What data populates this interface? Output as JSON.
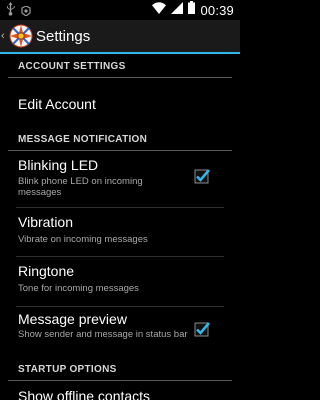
{
  "status_bar": {
    "time": "00:39",
    "icons": [
      "usb-icon",
      "android-debug-icon",
      "wifi-icon",
      "signal-icon",
      "battery-icon"
    ]
  },
  "action_bar": {
    "title": "Settings",
    "up_glyph": "‹"
  },
  "sections": {
    "account": {
      "header": "ACCOUNT SETTINGS",
      "items": {
        "edit_account": {
          "title": "Edit Account"
        }
      }
    },
    "message_notification": {
      "header": "MESSAGE NOTIFICATION",
      "items": {
        "blinking_led": {
          "title": "Blinking LED",
          "summary": "Blink phone LED on incoming messages",
          "checked": true
        },
        "vibration": {
          "title": "Vibration",
          "summary": "Vibrate on incoming messages"
        },
        "ringtone": {
          "title": "Ringtone",
          "summary": "Tone for incoming messages"
        },
        "message_preview": {
          "title": "Message preview",
          "summary": "Show sender and message in status bar",
          "checked": true
        }
      }
    },
    "startup": {
      "header": "STARTUP OPTIONS",
      "items": {
        "show_offline": {
          "title": "Show offline contacts"
        }
      }
    }
  },
  "colors": {
    "accent": "#33b5e5",
    "background": "#000000",
    "action_bar": "#1a1a1a",
    "summary_text": "#a8a8a8"
  }
}
